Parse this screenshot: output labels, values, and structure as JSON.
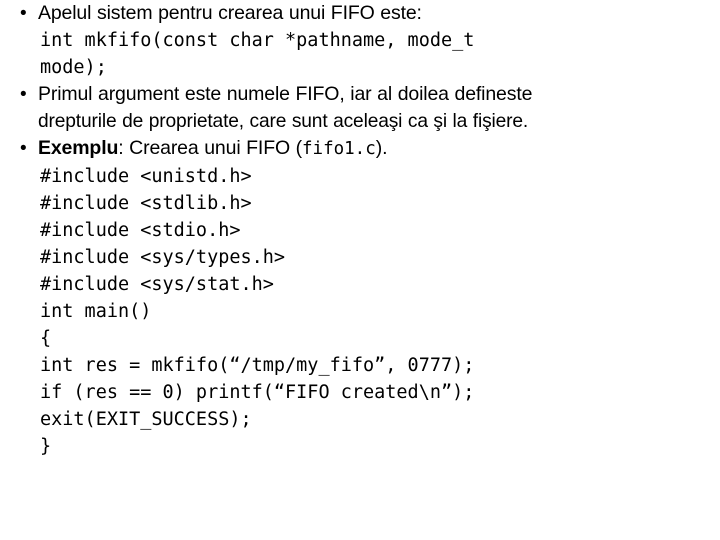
{
  "slide": {
    "background_color": "#ffffff",
    "text_color": "#000000",
    "bullet_glyph": "•",
    "lines": [
      {
        "id": "bullet-1",
        "kind": "bullet",
        "text": "Apelul sistem pentru crearea unui FIFO este:"
      },
      {
        "id": "code-signature-1",
        "kind": "code",
        "text": "int mkfifo(const char *pathname, mode_t"
      },
      {
        "id": "code-signature-2",
        "kind": "code",
        "text": "mode);"
      },
      {
        "id": "bullet-2-line-1",
        "kind": "bullet",
        "text": "Primul argument este numele FIFO, iar al doilea defineste"
      },
      {
        "id": "bullet-2-line-2",
        "kind": "continuation",
        "text": "drepturile de proprietate, care sunt aceleaşi ca şi la fişiere."
      },
      {
        "id": "bullet-3",
        "kind": "bullet-mixed",
        "label": "Exemplu",
        "text_after_label": ": Crearea unui FIFO (",
        "code_fragment": "fifo1.c",
        "text_tail": ")."
      },
      {
        "id": "code-include-unistd",
        "kind": "code",
        "text": "#include <unistd.h>"
      },
      {
        "id": "code-include-stdlib",
        "kind": "code",
        "text": "#include <stdlib.h>"
      },
      {
        "id": "code-include-stdio",
        "kind": "code",
        "text": "#include <stdio.h>"
      },
      {
        "id": "code-include-systypes",
        "kind": "code",
        "text": "#include <sys/types.h>"
      },
      {
        "id": "code-include-sysstat",
        "kind": "code",
        "text": "#include <sys/stat.h>"
      },
      {
        "id": "code-main",
        "kind": "code",
        "text": "int main()"
      },
      {
        "id": "code-brace-open",
        "kind": "code",
        "text": "{"
      },
      {
        "id": "code-mkfifo-call",
        "kind": "code",
        "text": "int res = mkfifo(“/tmp/my_fifo”, 0777);"
      },
      {
        "id": "code-if-printf",
        "kind": "code",
        "text": "if (res == 0) printf(“FIFO created\\n”);"
      },
      {
        "id": "code-exit",
        "kind": "code",
        "text": "exit(EXIT_SUCCESS);"
      },
      {
        "id": "code-brace-close",
        "kind": "code",
        "text": "}"
      }
    ]
  }
}
